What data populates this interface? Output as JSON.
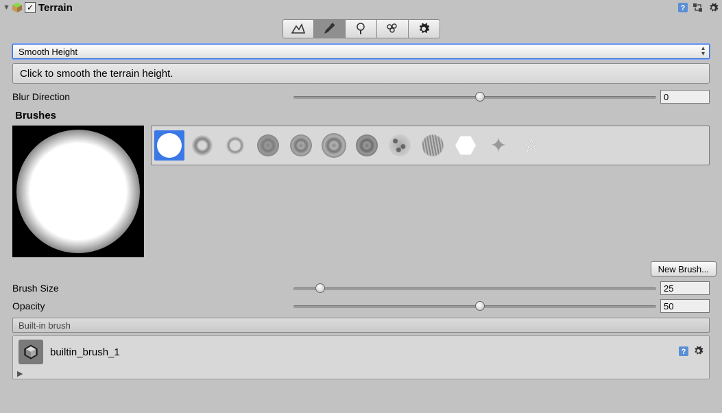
{
  "header": {
    "title": "Terrain",
    "checked": true
  },
  "tool_dropdown": {
    "value": "Smooth Height"
  },
  "help_text": "Click to smooth the terrain height.",
  "blur_direction": {
    "label": "Blur Direction",
    "value": "0",
    "handle_pct": 50
  },
  "brushes_title": "Brushes",
  "new_brush_btn": "New Brush...",
  "brush_size": {
    "label": "Brush Size",
    "value": "25",
    "handle_pct": 6
  },
  "opacity": {
    "label": "Opacity",
    "value": "50",
    "handle_pct": 50
  },
  "status_text": "Built-in brush",
  "asset": {
    "name": "builtin_brush_1"
  },
  "icons": {
    "help": "?",
    "gear": "✲",
    "mountain": "⛰",
    "brush": "🖌",
    "tree": "❀",
    "detail": "✿",
    "settings": "✲"
  }
}
